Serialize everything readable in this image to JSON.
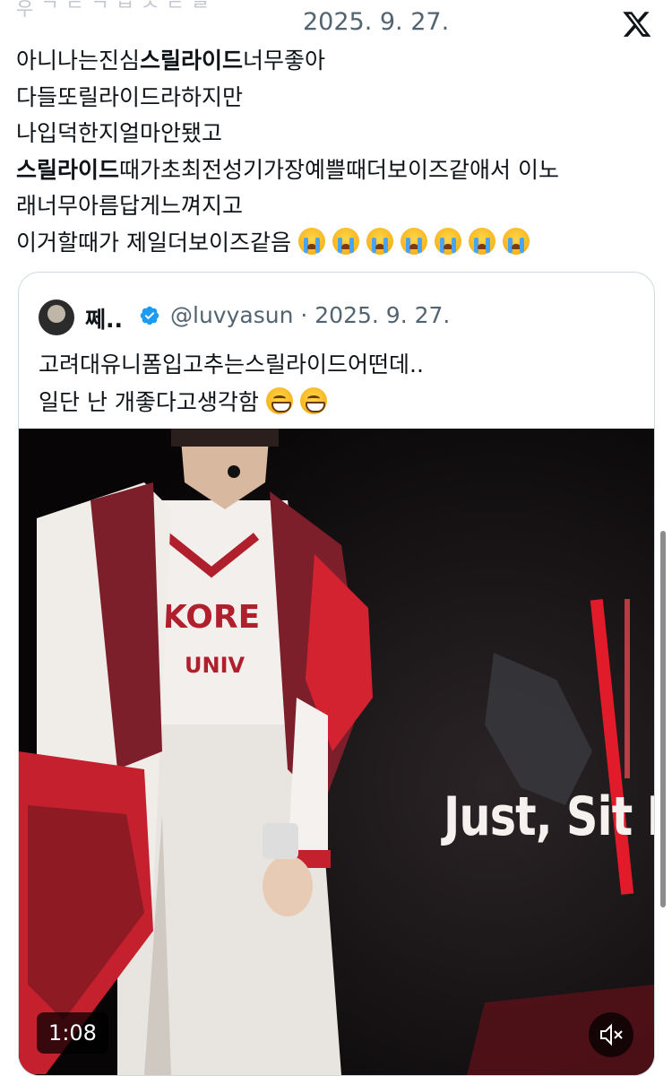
{
  "header": {
    "cut_name": "우 ᄀ ᄃ ᄀ ᄇ ᄉ ᄃ ᄅ",
    "date": "2025. 9. 27.",
    "logo_icon": "x-logo-icon"
  },
  "post": {
    "lines": [
      {
        "before": "아니나는진심",
        "bold": "스릴라이드",
        "after": "너무좋아"
      },
      {
        "before": "다들또릴라이드라하지만",
        "bold": "",
        "after": ""
      },
      {
        "before": "나입덕한지얼마안됐고",
        "bold": "",
        "after": ""
      },
      {
        "before": "",
        "bold": "스릴라이드",
        "after": "때가초최전성기가장예쁠때더보이즈같애서 이노"
      },
      {
        "before": "래너무아름답게느껴지고",
        "bold": "",
        "after": ""
      },
      {
        "before": "이거할때가 제일더보이즈같음",
        "bold": "",
        "after": ""
      }
    ],
    "emoji": "loudly-crying-face",
    "emoji_count": 7
  },
  "quote": {
    "name": "쩨..",
    "handle": "@luvyasun",
    "separator": " · ",
    "date": "2025. 9. 27.",
    "line1": "고려대유니폼입고추는스릴라이드어떤데..",
    "line2": "일단 난 개좋다고생각함",
    "emoji": "grinning-face-with-smiling-eyes",
    "emoji_count": 2,
    "verified_color": "#1d9bf0"
  },
  "video": {
    "caption": "Just, Sit I",
    "duration": "1:08",
    "mute_icon": "speaker-muted-icon"
  },
  "colors": {
    "text": "#0f1419",
    "muted": "#536471",
    "border": "#cfd9de",
    "jacket_red": "#b01f2c"
  }
}
